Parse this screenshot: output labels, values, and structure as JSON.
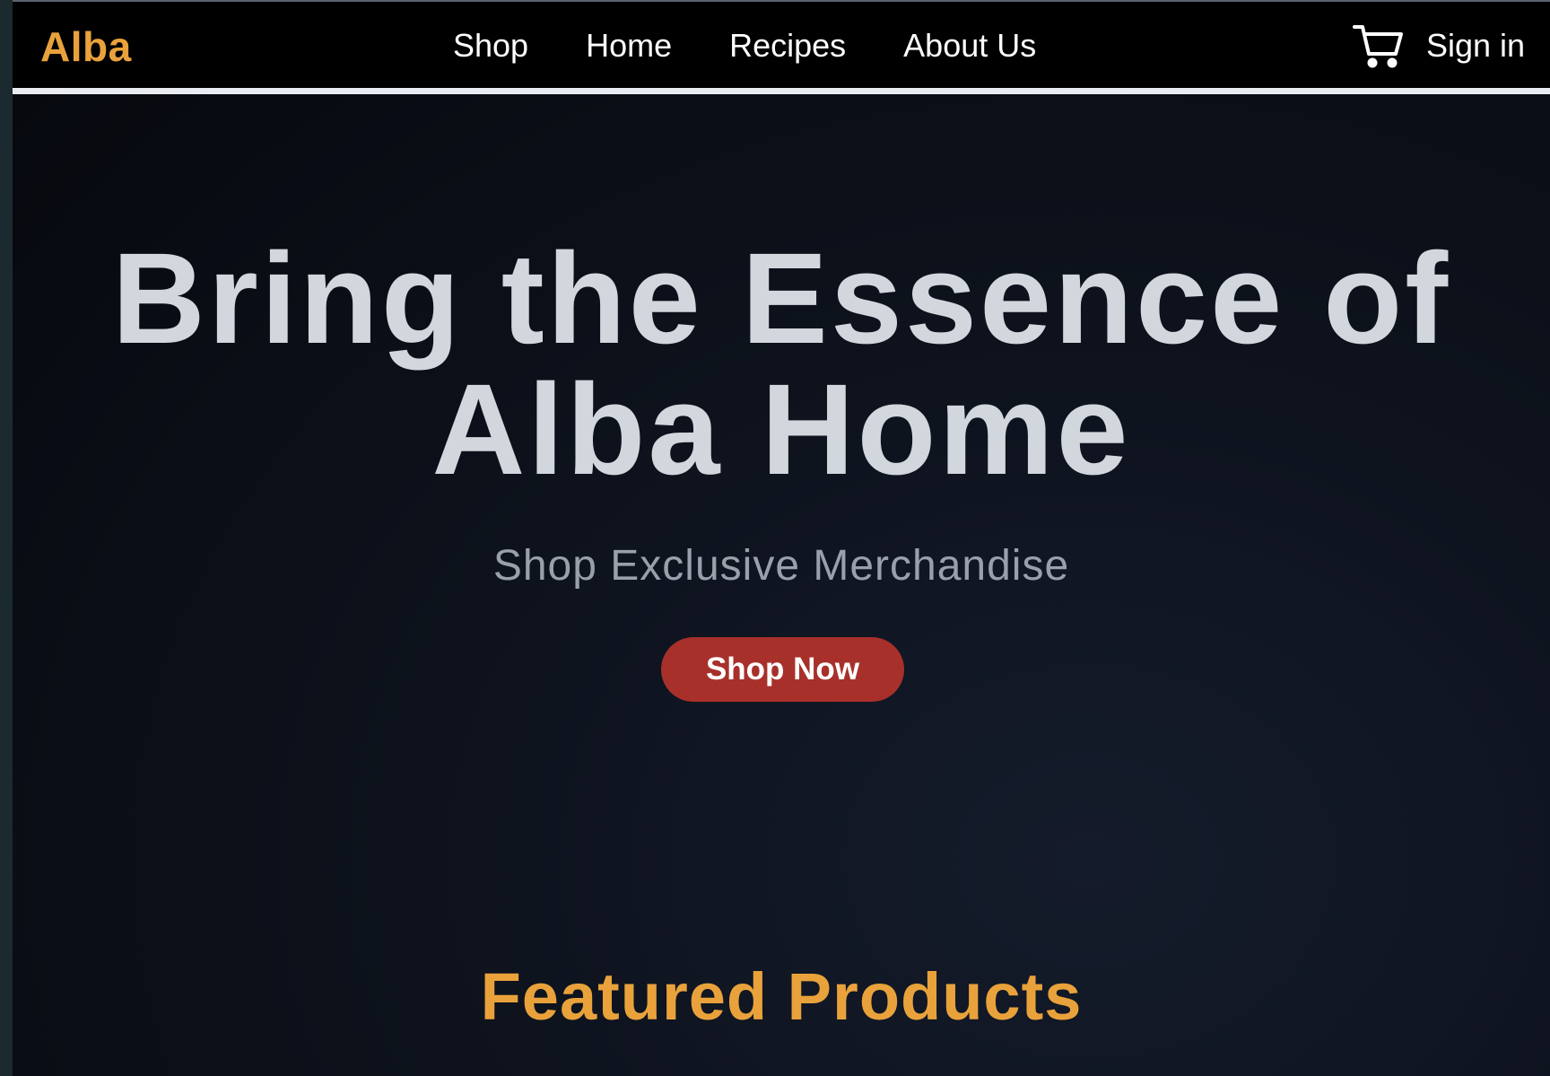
{
  "brand": {
    "name": "Alba",
    "accent_color": "#e9a23b"
  },
  "nav": {
    "links": [
      {
        "label": "Shop"
      },
      {
        "label": "Home"
      },
      {
        "label": "Recipes"
      },
      {
        "label": "About Us"
      }
    ],
    "cart_icon": "shopping-cart-icon",
    "signin_label": "Sign in"
  },
  "hero": {
    "title_line1": "Bring the Essence of",
    "title_line2": "Alba Home",
    "subtitle": "Shop Exclusive Merchandise",
    "cta_label": "Shop Now",
    "cta_color": "#a8302b"
  },
  "featured": {
    "title": "Featured Products"
  }
}
